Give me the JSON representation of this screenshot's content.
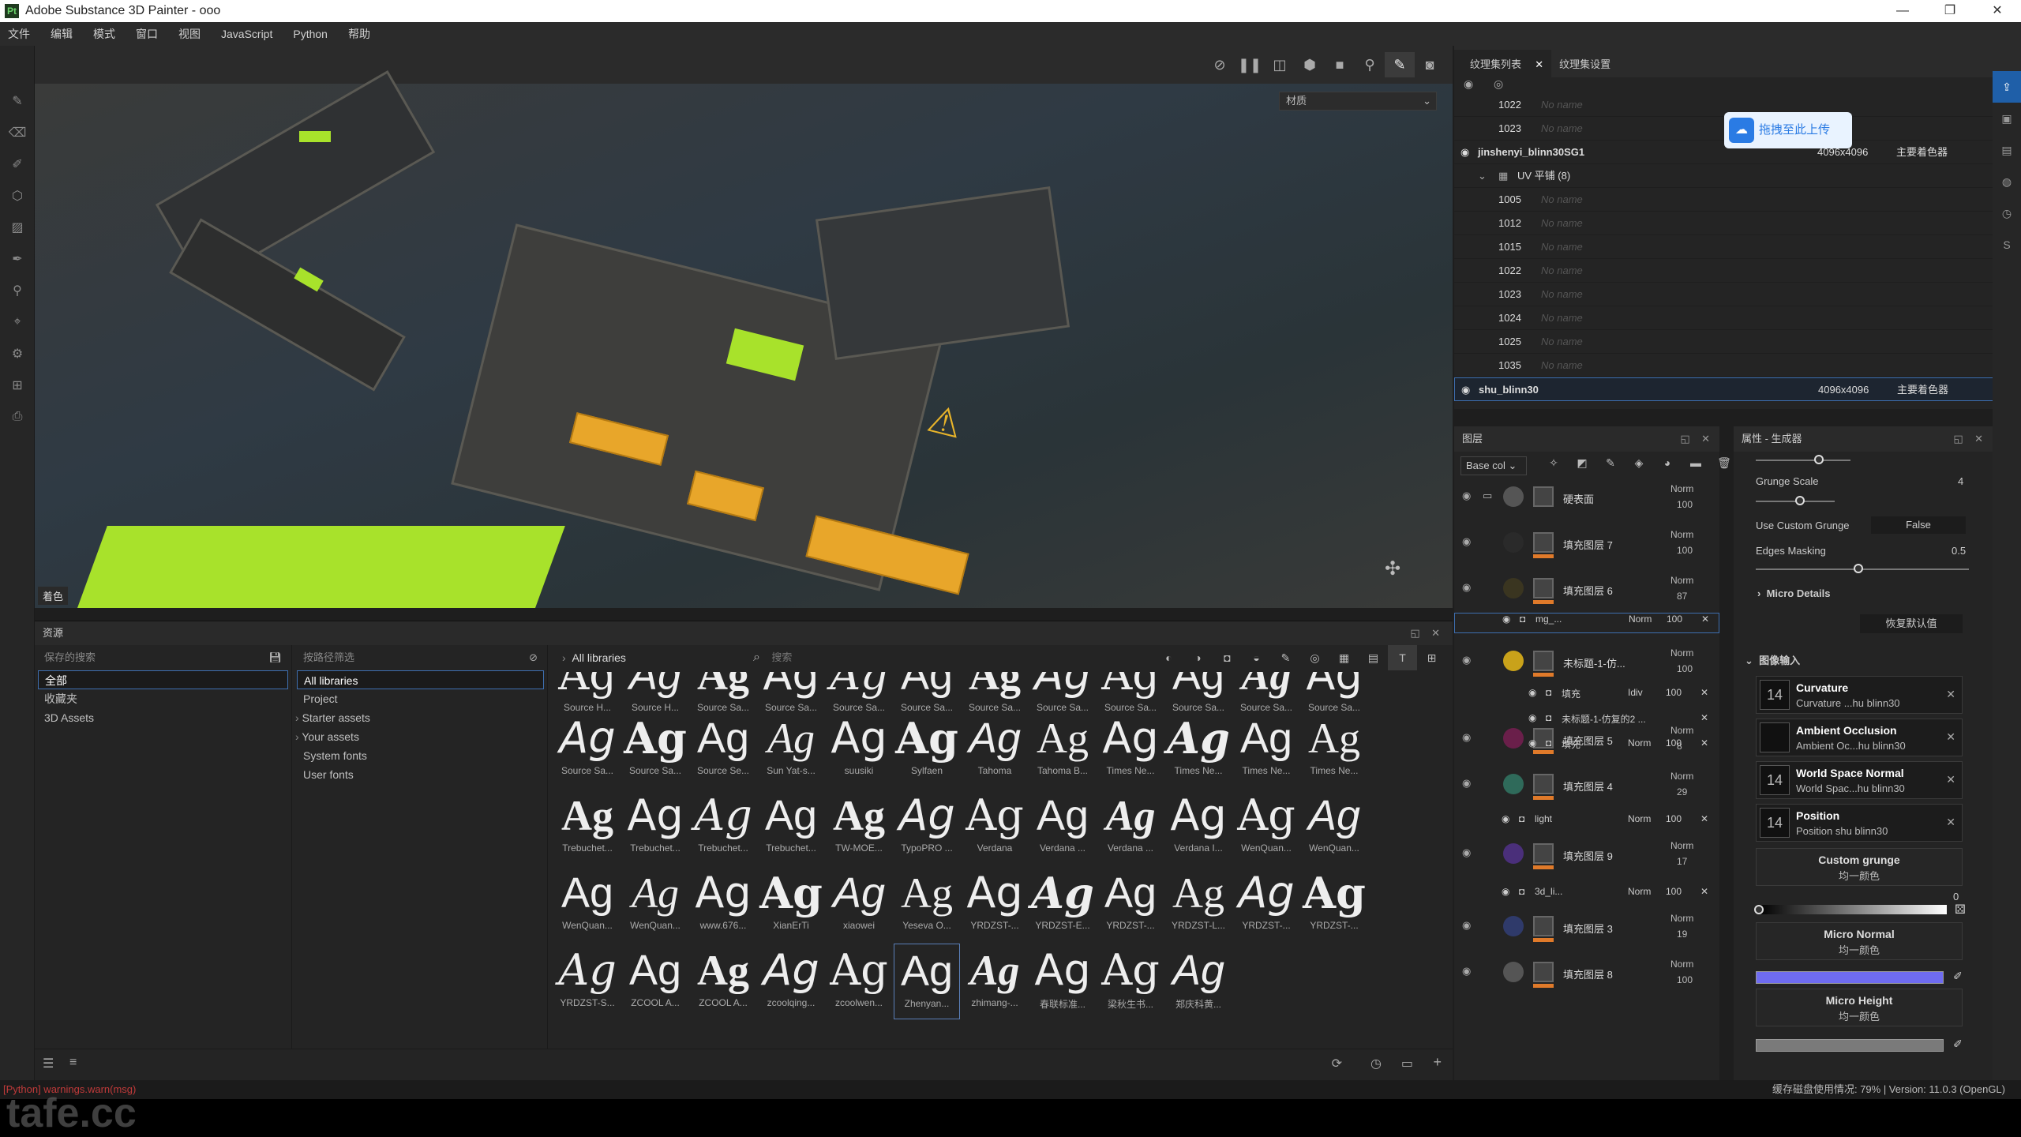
{
  "window": {
    "title": "Adobe Substance 3D Painter - ooo",
    "logo": "Pt",
    "min": "—",
    "max": "❐",
    "close": "✕"
  },
  "menu": [
    "文件",
    "编辑",
    "模式",
    "窗口",
    "视图",
    "JavaScript",
    "Python",
    "帮助"
  ],
  "viewport": {
    "material_dropdown": "材质",
    "corner_label": "着色"
  },
  "assets": {
    "title": "资源",
    "saved_search_label": "保存的搜索",
    "filter_label": "按路径筛选",
    "saved_items": [
      "全部",
      "收藏夹",
      "3D Assets"
    ],
    "filter_items": [
      "All libraries",
      "Project",
      "Starter assets",
      "Your assets",
      "System fonts",
      "User fonts"
    ],
    "breadcrumb": "All libraries",
    "search_placeholder": "搜索",
    "fonts_row0": [
      "Source H...",
      "Source H...",
      "Source Sa...",
      "Source Sa...",
      "Source Sa...",
      "Source Sa...",
      "Source Sa...",
      "Source Sa...",
      "Source Sa...",
      "Source Sa...",
      "Source Sa...",
      "Source Sa..."
    ],
    "fonts_row1": [
      "Source Sa...",
      "Source Sa...",
      "Source Se...",
      "Sun Yat-s...",
      "suusiki",
      "Sylfaen",
      "Tahoma",
      "Tahoma B...",
      "Times Ne...",
      "Times Ne...",
      "Times Ne...",
      "Times Ne..."
    ],
    "fonts_row2": [
      "Trebuchet...",
      "Trebuchet...",
      "Trebuchet...",
      "Trebuchet...",
      "TW-MOE...",
      "TypoPRO ...",
      "Verdana",
      "Verdana ...",
      "Verdana ...",
      "Verdana I...",
      "WenQuan...",
      "WenQuan..."
    ],
    "fonts_row3": [
      "WenQuan...",
      "WenQuan...",
      "www.676...",
      "XianErTi",
      "xiaowei",
      "Yeseva O...",
      "YRDZST-...",
      "YRDZST-E...",
      "YRDZST-...",
      "YRDZST-L...",
      "YRDZST-...",
      "YRDZST-..."
    ],
    "fonts_row4": [
      "YRDZST-S...",
      "ZCOOL A...",
      "ZCOOL A...",
      "zcoolqing...",
      "zcoolwen...",
      "Zhenyan...",
      "zhimang-...",
      "春联标准...",
      "梁秋生书...",
      "郑庆科黄..."
    ],
    "glyph": "Ag"
  },
  "texture_sets": {
    "tab_list": "纹理集列表",
    "tab_settings": "纹理集设置",
    "rows": [
      {
        "num": "1022",
        "name": "No name"
      },
      {
        "num": "1023",
        "name": "No name"
      }
    ],
    "set1": {
      "name": "jinshenyi_blinn30SG1",
      "res": "4096x4096",
      "shader": "主要着色器"
    },
    "uv_group": "UV 平铺 (8)",
    "uv_rows": [
      {
        "num": "1005",
        "name": "No name"
      },
      {
        "num": "1012",
        "name": "No name"
      },
      {
        "num": "1015",
        "name": "No name"
      },
      {
        "num": "1022",
        "name": "No name"
      },
      {
        "num": "1023",
        "name": "No name"
      },
      {
        "num": "1024",
        "name": "No name"
      },
      {
        "num": "1025",
        "name": "No name"
      },
      {
        "num": "1035",
        "name": "No name"
      }
    ],
    "set2": {
      "name": "shu_blinn30",
      "res": "4096x4096",
      "shader": "主要着色器"
    },
    "upload_label": "拖拽至此上传"
  },
  "layers": {
    "title": "图层",
    "blend": "Base col",
    "items": [
      {
        "name": "硬表面",
        "mode": "Norm",
        "op": "100"
      },
      {
        "name": "填充图层 7",
        "mode": "Norm",
        "op": "100"
      },
      {
        "name": "填充图层 6",
        "mode": "Norm",
        "op": "87"
      },
      {
        "name": "未标题-1-仿...",
        "mode": "Norm",
        "op": "100"
      },
      {
        "name": "填充图层 5",
        "mode": "Norm",
        "op": "8"
      },
      {
        "name": "填充图层 4",
        "mode": "Norm",
        "op": "29"
      },
      {
        "name": "填充图层 9",
        "mode": "Norm",
        "op": "17"
      },
      {
        "name": "填充图层 3",
        "mode": "Norm",
        "op": "19"
      },
      {
        "name": "填充图层 8",
        "mode": "Norm",
        "op": "100"
      }
    ],
    "subs": {
      "mg": {
        "name": "mg_...",
        "mode": "Norm",
        "op": "100"
      },
      "fill1": {
        "name": "填充",
        "mode": "Idiv",
        "op": "100"
      },
      "sub2": {
        "name": "未标题-1-仿复的2 ..."
      },
      "fill2": {
        "name": "填充",
        "mode": "Norm",
        "op": "100"
      },
      "light": {
        "name": "light",
        "mode": "Norm",
        "op": "100"
      },
      "d3": {
        "name": "3d_li...",
        "mode": "Norm",
        "op": "100"
      }
    }
  },
  "properties": {
    "title": "属性 - 生成器",
    "grunge_scale_label": "Grunge Scale",
    "grunge_scale_value": "4",
    "use_custom_grunge_label": "Use Custom Grunge",
    "use_custom_grunge_value": "False",
    "edges_masking_label": "Edges Masking",
    "edges_masking_value": "0.5",
    "micro_details": "Micro Details",
    "reset_default": "恢复默认值",
    "image_inputs": "图像输入",
    "inputs": [
      {
        "title": "Curvature",
        "sub": "Curvature ...hu blinn30",
        "icon": "14"
      },
      {
        "title": "Ambient Occlusion",
        "sub": "Ambient Oc...hu blinn30",
        "icon": ""
      },
      {
        "title": "World Space Normal",
        "sub": "World Spac...hu blinn30",
        "icon": "14"
      },
      {
        "title": "Position",
        "sub": "Position shu blinn30",
        "icon": "14"
      }
    ],
    "custom_grunge": {
      "title": "Custom grunge",
      "sub": "均一颜色"
    },
    "gradient_value": "0",
    "micro_normal": {
      "title": "Micro Normal",
      "sub": "均一颜色",
      "color": "#6f6cf0"
    },
    "micro_height": {
      "title": "Micro Height",
      "sub": "均一颜色"
    }
  },
  "status": {
    "warning": "[Python] warnings.warn(msg)",
    "right": "缓存磁盘使用情况:     79% | Version: 11.0.3 (OpenGL)"
  },
  "watermark": "tafe.cc"
}
